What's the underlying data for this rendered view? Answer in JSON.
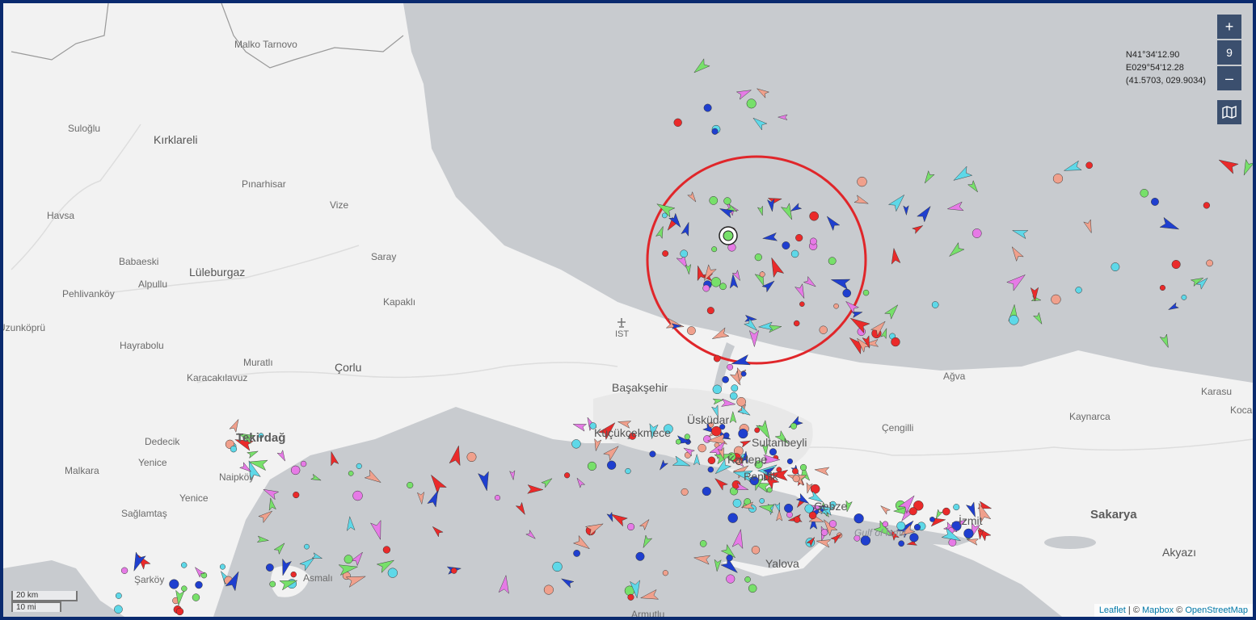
{
  "zoom": {
    "in_label": "+",
    "level": "9",
    "out_label": "–"
  },
  "coords": {
    "lat": "N41°34'12.90",
    "lon": "E029°54'12.28",
    "decimal": "(41.5703, 029.9034)"
  },
  "scale": {
    "metric": "20 km",
    "imperial": "10 mi"
  },
  "attribution": {
    "leaflet": "Leaflet",
    "sep1": " | © ",
    "mapbox": "Mapbox",
    "sep2": " © ",
    "osm": "OpenStreetMap"
  },
  "places": [
    "Malko Tarnovo",
    "Kırklareli",
    "Suloğlu",
    "Pınarhisar",
    "Vize",
    "Havsa",
    "Babaeski",
    "Saray",
    "Lüleburgaz",
    "Alpullu",
    "Pehlivanköy",
    "Kapaklı",
    "Uzunköprü",
    "Hayrabolu",
    "Muratlı",
    "Çorlu",
    "Karacakılavuz",
    "IST",
    "Başakşehir",
    "Üsküdar",
    "Küçükçekmece",
    "Sultanbeyli",
    "Çengilli",
    "Ağva",
    "Karasu",
    "Kaynarca",
    "Kocaali",
    "Tekirdağ",
    "Dedecik",
    "Yenice",
    "Malkara",
    "Naipköy",
    "Yenice",
    "Sağlamtaş",
    "Şarköy",
    "Asmalı",
    "Kartepe",
    "Pendik",
    "Gebze",
    "Gulf of İzmit",
    "İzmit",
    "Sakarya",
    "Akyazı",
    "Yalova",
    "Armutlu",
    "Şarköy"
  ],
  "icons": {
    "layers": "map-layers-icon",
    "airport": "airport-icon",
    "selected": "selected-vessel-icon"
  },
  "colors": {
    "sea": "#c8cbcf",
    "land": "#f2f2f2",
    "cargo": "#77e06a",
    "tanker": "#ea2a2a",
    "passenger": "#1f3fcf",
    "fishing": "#f0a08c",
    "tug": "#5ed8e8",
    "pleasure": "#e67ae6",
    "highlight": "#e0262a"
  }
}
